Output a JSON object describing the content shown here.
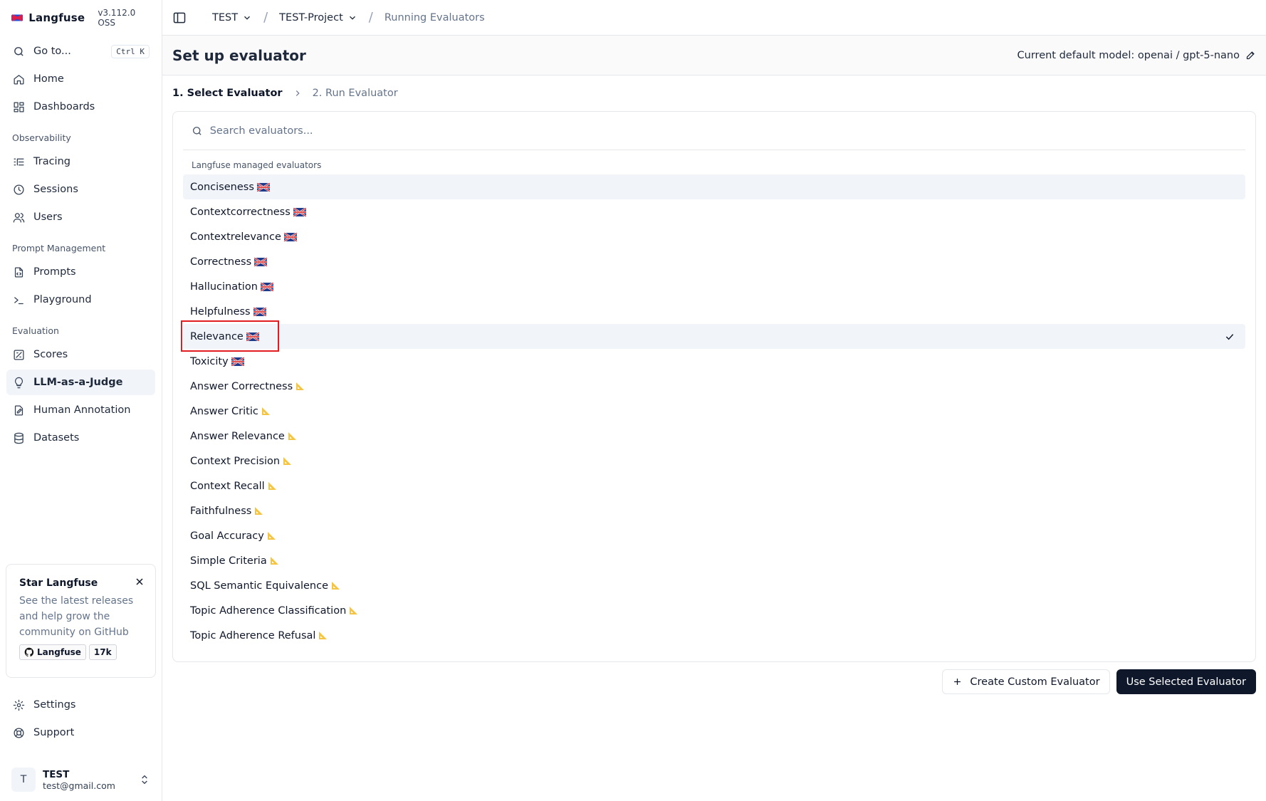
{
  "brand": {
    "name": "Langfuse",
    "version": "v3.112.0 OSS"
  },
  "sidebar": {
    "goto": {
      "label": "Go to...",
      "shortcut": "Ctrl K"
    },
    "top_items": [
      {
        "label": "Home",
        "icon": "home-icon"
      },
      {
        "label": "Dashboards",
        "icon": "dashboard-icon"
      }
    ],
    "sections": [
      {
        "title": "Observability",
        "items": [
          {
            "label": "Tracing",
            "icon": "tracing-icon"
          },
          {
            "label": "Sessions",
            "icon": "clock-icon"
          },
          {
            "label": "Users",
            "icon": "users-icon"
          }
        ]
      },
      {
        "title": "Prompt Management",
        "items": [
          {
            "label": "Prompts",
            "icon": "file-code-icon"
          },
          {
            "label": "Playground",
            "icon": "terminal-icon"
          }
        ]
      },
      {
        "title": "Evaluation",
        "items": [
          {
            "label": "Scores",
            "icon": "score-icon"
          },
          {
            "label": "LLM-as-a-Judge",
            "icon": "lightbulb-icon",
            "active": true
          },
          {
            "label": "Human Annotation",
            "icon": "annotation-icon"
          },
          {
            "label": "Datasets",
            "icon": "database-icon"
          }
        ]
      }
    ],
    "star": {
      "title": "Star Langfuse",
      "text": "See the latest releases and help grow the community on GitHub",
      "badge_label": "Langfuse",
      "badge_count": "17k"
    },
    "bottom_items": [
      {
        "label": "Settings",
        "icon": "gear-icon"
      },
      {
        "label": "Support",
        "icon": "lifebuoy-icon"
      }
    ],
    "user": {
      "initial": "T",
      "name": "TEST",
      "email": "test@gmail.com"
    }
  },
  "topbar": {
    "org": "TEST",
    "project": "TEST-Project",
    "page": "Running Evaluators"
  },
  "header": {
    "title": "Set up evaluator",
    "model_info": "Current default model: openai / gpt-5-nano"
  },
  "steps": {
    "step1": "1. Select Evaluator",
    "step2": "2. Run Evaluator"
  },
  "search": {
    "placeholder": "Search evaluators..."
  },
  "group_label": "Langfuse managed evaluators",
  "evaluators": [
    {
      "label": "Conciseness",
      "badge": "flag"
    },
    {
      "label": "Contextcorrectness",
      "badge": "flag"
    },
    {
      "label": "Contextrelevance",
      "badge": "flag"
    },
    {
      "label": "Correctness",
      "badge": "flag"
    },
    {
      "label": "Hallucination",
      "badge": "flag"
    },
    {
      "label": "Helpfulness",
      "badge": "flag"
    },
    {
      "label": "Relevance",
      "badge": "flag",
      "selected": true
    },
    {
      "label": "Toxicity",
      "badge": "flag"
    },
    {
      "label": "Answer Correctness",
      "badge": "ruler"
    },
    {
      "label": "Answer Critic",
      "badge": "ruler"
    },
    {
      "label": "Answer Relevance",
      "badge": "ruler"
    },
    {
      "label": "Context Precision",
      "badge": "ruler"
    },
    {
      "label": "Context Recall",
      "badge": "ruler"
    },
    {
      "label": "Faithfulness",
      "badge": "ruler"
    },
    {
      "label": "Goal Accuracy",
      "badge": "ruler"
    },
    {
      "label": "Simple Criteria",
      "badge": "ruler"
    },
    {
      "label": "SQL Semantic Equivalence",
      "badge": "ruler"
    },
    {
      "label": "Topic Adherence Classification",
      "badge": "ruler"
    },
    {
      "label": "Topic Adherence Refusal",
      "badge": "ruler"
    }
  ],
  "actions": {
    "create_custom": "Create Custom Evaluator",
    "use_selected": "Use Selected Evaluator"
  },
  "colors": {
    "primary": "#0f172a",
    "highlight": "#f1f5f9",
    "annotation_box": "#e11d21",
    "ruler_icon": "#f5c542"
  }
}
